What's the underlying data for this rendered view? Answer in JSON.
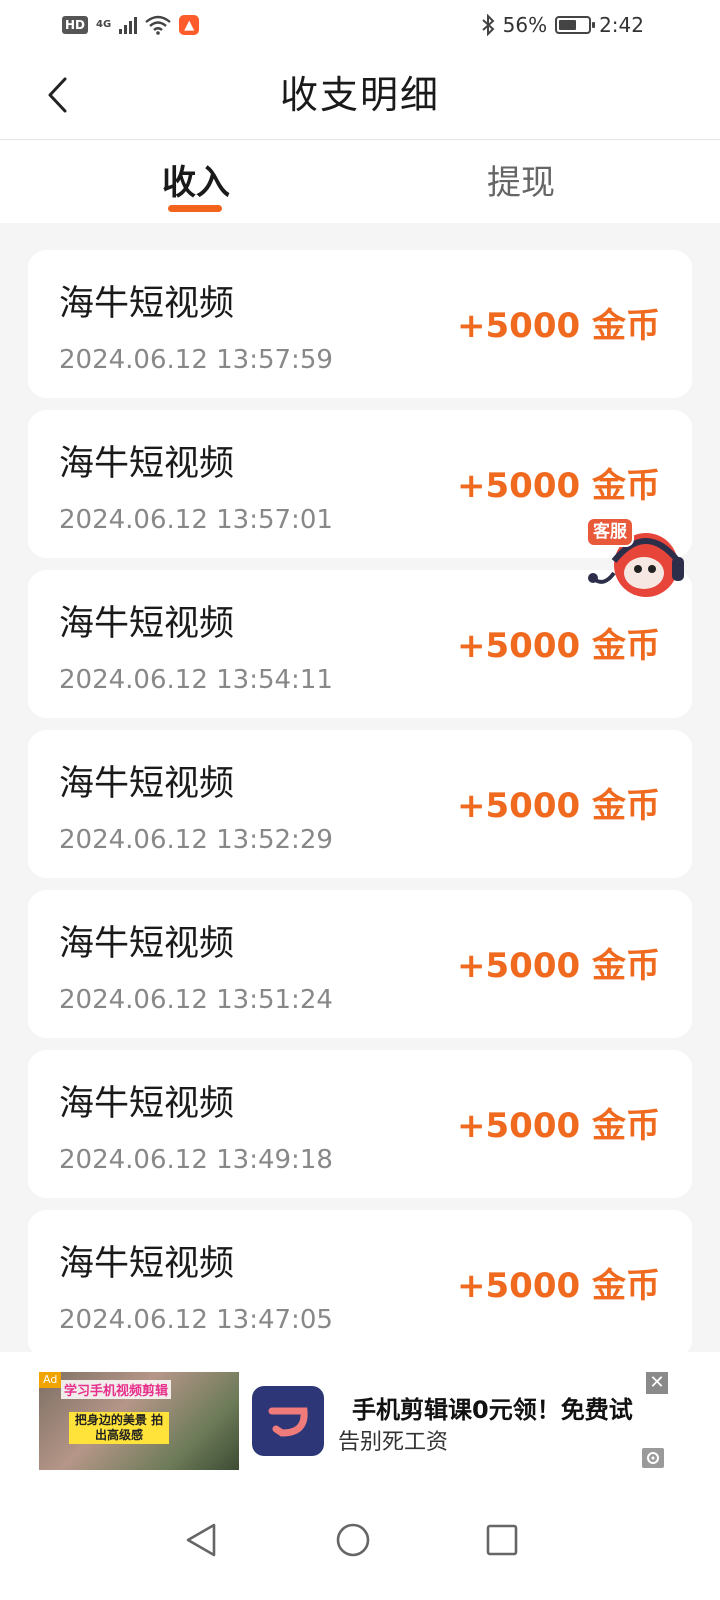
{
  "status_bar": {
    "hd": "HD",
    "network": "4G",
    "bluetooth_icon": "bluetooth-icon",
    "battery_percent": "56%",
    "battery_level": 0.56,
    "time": "2:42"
  },
  "header": {
    "title": "收支明细",
    "back_icon": "chevron-left-icon"
  },
  "tabs": [
    {
      "label": "收入",
      "active": true
    },
    {
      "label": "提现",
      "active": false
    }
  ],
  "accent_color": "#ef6a1e",
  "records": [
    {
      "source": "海牛短视频",
      "time": "2024.06.12 13:57:59",
      "amount": "+5000 金币"
    },
    {
      "source": "海牛短视频",
      "time": "2024.06.12 13:57:01",
      "amount": "+5000 金币"
    },
    {
      "source": "海牛短视频",
      "time": "2024.06.12 13:54:11",
      "amount": "+5000 金币"
    },
    {
      "source": "海牛短视频",
      "time": "2024.06.12 13:52:29",
      "amount": "+5000 金币"
    },
    {
      "source": "海牛短视频",
      "time": "2024.06.12 13:51:24",
      "amount": "+5000 金币"
    },
    {
      "source": "海牛短视频",
      "time": "2024.06.12 13:49:18",
      "amount": "+5000 金币"
    },
    {
      "source": "海牛短视频",
      "time": "2024.06.12 13:47:05",
      "amount": "+5000 金币"
    }
  ],
  "customer_service": {
    "label": "客服"
  },
  "ad": {
    "tag": "Ad",
    "thumb_line1": "学习手机视频剪辑",
    "thumb_line2": "把身边的美景 拍出高级感",
    "title": "手机剪辑课0元领！免费试",
    "subtitle": "告别死工资",
    "close_icon": "close-icon",
    "info_icon": "ad-info-icon"
  },
  "navigation": {
    "back_icon": "nav-back-icon",
    "home_icon": "nav-home-icon",
    "recents_icon": "nav-recents-icon"
  }
}
